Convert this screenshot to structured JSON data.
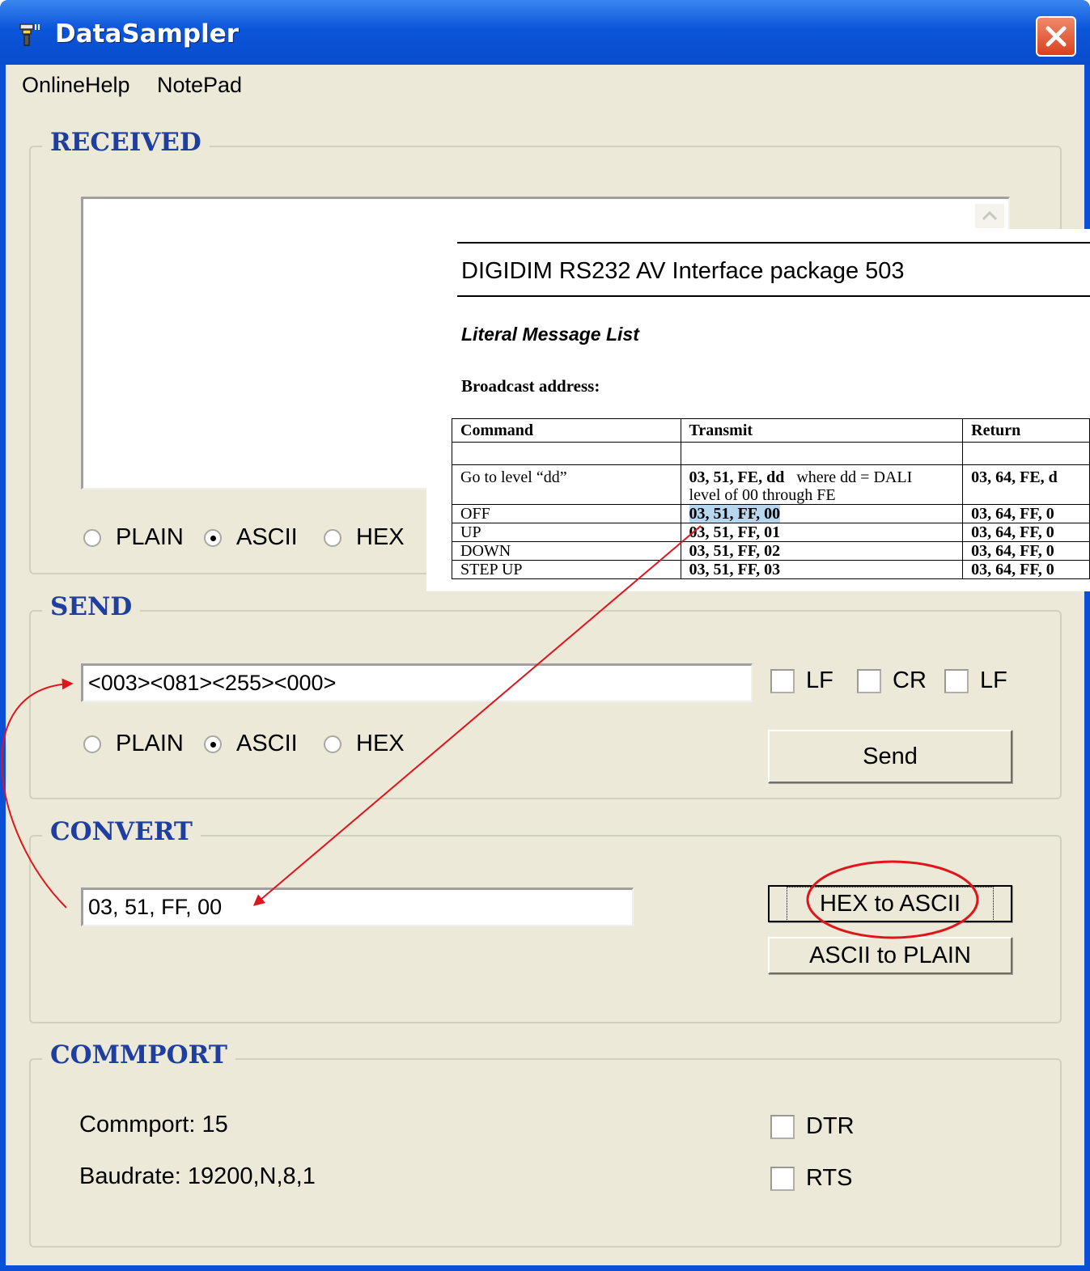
{
  "window": {
    "title": "DataSampler",
    "icon": "sampler-app-icon",
    "close_icon": "close-icon"
  },
  "menu": {
    "items": [
      "OnlineHelp",
      "NotePad"
    ]
  },
  "received": {
    "label": "RECEIVED",
    "content": "",
    "modes": [
      "PLAIN",
      "ASCII",
      "HEX"
    ],
    "selected_mode": "ASCII"
  },
  "send": {
    "label": "SEND",
    "value": "<003><081><255><000>",
    "checkboxes": [
      {
        "label": "LF",
        "checked": false
      },
      {
        "label": "CR",
        "checked": false
      },
      {
        "label": "LF",
        "checked": false
      }
    ],
    "modes": [
      "PLAIN",
      "ASCII",
      "HEX"
    ],
    "selected_mode": "ASCII",
    "send_button": "Send"
  },
  "convert": {
    "label": "CONVERT",
    "value": "03, 51, FF, 00",
    "hex_to_ascii_button": "HEX to ASCII",
    "ascii_to_plain_button": "ASCII to PLAIN"
  },
  "commport": {
    "label": "COMMPORT",
    "port_text": "Commport: 15",
    "baud_text": "Baudrate: 19200,N,8,1",
    "dtr_label": "DTR",
    "rts_label": "RTS",
    "dtr_checked": false,
    "rts_checked": false
  },
  "document": {
    "title": "DIGIDIM RS232 AV Interface package 503",
    "subtitle": "Literal Message List",
    "broadcast": "Broadcast address:",
    "headers": [
      "Command",
      "Transmit",
      "Return"
    ],
    "rows": [
      {
        "command": "",
        "transmit": "",
        "transmit_note": "",
        "return": ""
      },
      {
        "command": "Go to level “dd”",
        "transmit": "03, 51, FE, dd",
        "transmit_note": "where dd = DALI",
        "transmit_line2": "level of 00 through FE",
        "return": "03, 64, FE, d"
      },
      {
        "command": "OFF",
        "transmit": "03, 51, FF, 00",
        "return": "03, 64, FF, 0"
      },
      {
        "command": "UP",
        "transmit": "03, 51, FF, 01",
        "return": "03, 64, FF, 0"
      },
      {
        "command": "DOWN",
        "transmit": "03, 51, FF, 02",
        "return": "03, 64, FF, 0"
      },
      {
        "command": "STEP UP",
        "transmit": "03, 51, FF, 03",
        "return": "03, 64, FF, 0"
      }
    ]
  },
  "colors": {
    "annotation": "#e0141b",
    "group_label": "#1f3fa0",
    "highlight": "#b6d7ee"
  }
}
